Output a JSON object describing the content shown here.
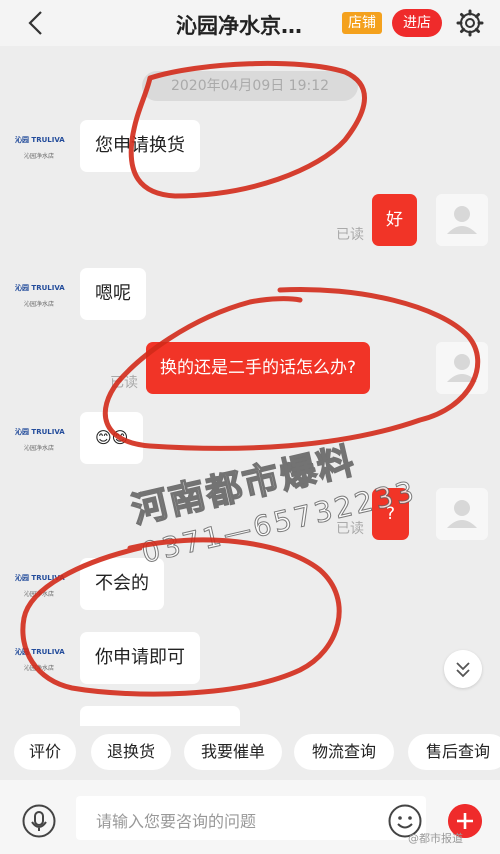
{
  "header": {
    "title": "沁园净水京…",
    "shop_badge": "店铺",
    "enter_button": "进店"
  },
  "chat": {
    "timestamp": "2020年04月09日 19:12",
    "shop_logo": {
      "mark": "沁园 TRULIVA",
      "sub": "沁园净水店"
    },
    "messages": [
      {
        "from": "shop",
        "text": "您申请换货"
      },
      {
        "from": "user",
        "text": "好",
        "status": "已读"
      },
      {
        "from": "shop",
        "text": "嗯呢"
      },
      {
        "from": "user",
        "text": "换的还是二手的话怎么办?",
        "status": "已读"
      },
      {
        "from": "shop",
        "text": "😊😊"
      },
      {
        "from": "user",
        "text": "?",
        "status": "已读"
      },
      {
        "from": "shop",
        "text": "不会的"
      },
      {
        "from": "shop",
        "text": "你申请即可"
      }
    ]
  },
  "watermark": {
    "title": "河南都市爆料",
    "phone": "0371—65732233"
  },
  "quick_actions": [
    "评价",
    "退换货",
    "我要催单",
    "物流查询",
    "售后查询"
  ],
  "input": {
    "placeholder": "请输入您要咨询的问题"
  },
  "source_mark": "@都市报道",
  "colors": {
    "accent_red": "#ef2b2b",
    "shop_badge": "#f4a11d",
    "annotation_red": "#d12a1a"
  },
  "icons": [
    "back-icon",
    "settings-icon",
    "avatar-icon",
    "chevron-down-icon",
    "microphone-icon",
    "emoji-icon",
    "plus-icon"
  ]
}
